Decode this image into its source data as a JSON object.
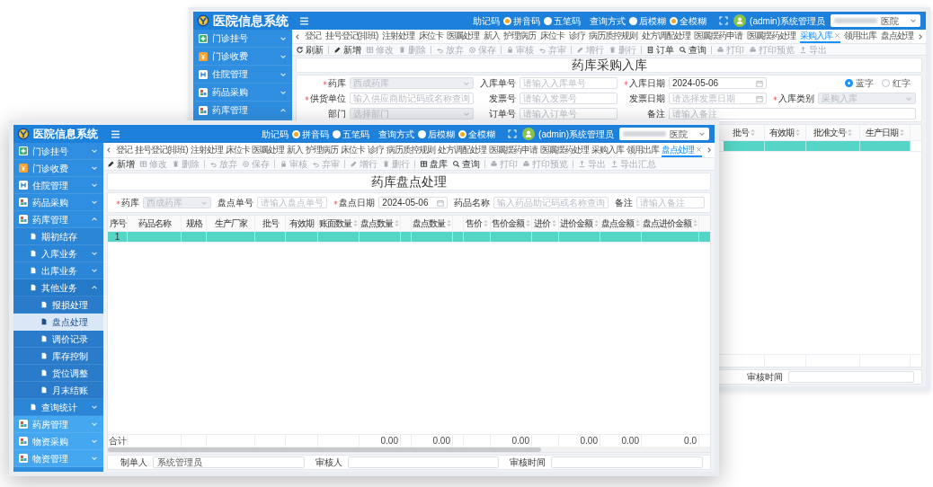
{
  "back_window": {
    "logo_text": "医院信息系统",
    "header": {
      "mnemonic_label": "助记码",
      "mnemonic_options": [
        {
          "label": "拼音码",
          "selected": true
        },
        {
          "label": "五笔码",
          "selected": false
        }
      ],
      "query_label": "查询方式",
      "query_options": [
        {
          "label": "后模糊",
          "selected": false
        },
        {
          "label": "全模糊",
          "selected": true
        }
      ],
      "user": "(admin)系统管理员",
      "hospital": "医院"
    },
    "sidebar": [
      {
        "label": "门诊挂号",
        "expanded": false,
        "selected": false
      },
      {
        "label": "门诊收费",
        "expanded": false,
        "selected": false
      },
      {
        "label": "住院管理",
        "expanded": false,
        "selected": false
      },
      {
        "label": "药品采购",
        "expanded": false,
        "selected": false
      },
      {
        "label": "药库管理",
        "expanded": true,
        "selected": false
      }
    ],
    "tabs": [
      {
        "label": "登记",
        "selected": false
      },
      {
        "label": "挂号登记(排班)",
        "selected": false
      },
      {
        "label": "注射处理",
        "selected": false
      },
      {
        "label": "床位卡",
        "selected": false
      },
      {
        "label": "医嘱处理",
        "selected": false
      },
      {
        "label": "新入",
        "selected": false
      },
      {
        "label": "护理病历",
        "selected": false
      },
      {
        "label": "床位卡",
        "selected": false
      },
      {
        "label": "诊疗",
        "selected": false
      },
      {
        "label": "病历质控规则",
        "selected": false
      },
      {
        "label": "处方调配处理",
        "selected": false
      },
      {
        "label": "医嘱摆药申请",
        "selected": false
      },
      {
        "label": "医嘱摆药处理",
        "selected": false
      },
      {
        "label": "采购入库",
        "selected": true
      },
      {
        "label": "领用出库",
        "selected": false
      },
      {
        "label": "盘点处理",
        "selected": false
      }
    ],
    "toolbar": [
      [
        {
          "label": "刷新",
          "disabled": false
        }
      ],
      [
        {
          "label": "新增",
          "disabled": false
        },
        {
          "label": "修改",
          "disabled": true
        },
        {
          "label": "删除",
          "disabled": true
        }
      ],
      [
        {
          "label": "放弃",
          "disabled": true
        },
        {
          "label": "保存",
          "disabled": true
        }
      ],
      [
        {
          "label": "审核",
          "disabled": true
        },
        {
          "label": "弃审",
          "disabled": true
        }
      ],
      [
        {
          "label": "增行",
          "disabled": true
        },
        {
          "label": "删行",
          "disabled": true
        }
      ],
      [
        {
          "label": "订单",
          "disabled": false
        },
        {
          "label": "查询",
          "disabled": false
        }
      ],
      [
        {
          "label": "打印",
          "disabled": true
        },
        {
          "label": "打印预览",
          "disabled": true
        },
        {
          "label": "导出",
          "disabled": true
        }
      ]
    ],
    "page_title": "药库采购入库",
    "form": [
      [
        {
          "label": "药库",
          "required": true,
          "kind": "select",
          "value": "西成药库",
          "disabled": true
        },
        {
          "label": "入库单号",
          "required": false,
          "kind": "text",
          "placeholder": "请输入入库单号",
          "disabled": false
        },
        {
          "label": "入库日期",
          "required": true,
          "kind": "date",
          "value": "2024-05-06",
          "disabled": false
        },
        {
          "kind": "radio",
          "options": [
            {
              "label": "蓝字",
              "selected": true
            },
            {
              "label": "红字",
              "selected": false
            }
          ]
        }
      ],
      [
        {
          "label": "供货单位",
          "required": true,
          "kind": "text",
          "placeholder": "输入供应商助记码或名称查询",
          "disabled": false
        },
        {
          "label": "发票号",
          "required": false,
          "kind": "text",
          "placeholder": "请输入发票号",
          "disabled": false
        },
        {
          "label": "发票日期",
          "required": false,
          "kind": "date",
          "placeholder": "请选择发票日期",
          "disabled": false
        },
        {
          "label": "入库类别",
          "required": true,
          "kind": "select",
          "value": "采购入库",
          "disabled": true
        }
      ],
      [
        {
          "label": "部门",
          "required": false,
          "kind": "select",
          "placeholder": "选择部门",
          "disabled": true
        },
        {
          "label": "订单号",
          "required": false,
          "kind": "text",
          "placeholder": "请输入订单号",
          "disabled": false
        },
        {
          "label": "备注",
          "required": false,
          "kind": "text",
          "placeholder": "请输入备注",
          "disabled": false
        }
      ]
    ],
    "table": {
      "columns": [
        {
          "label": "批号",
          "sortable": true
        },
        {
          "label": "有效期",
          "sortable": true
        },
        {
          "label": "批准文号",
          "sortable": true
        },
        {
          "label": "生产日期",
          "sortable": true
        }
      ],
      "rows": [
        {
          "selected": true
        }
      ]
    },
    "footer": [
      {
        "label": "审核时间"
      }
    ]
  },
  "front_window": {
    "logo_text": "医院信息系统",
    "header": {
      "mnemonic_label": "助记码",
      "mnemonic_options": [
        {
          "label": "拼音码",
          "selected": true
        },
        {
          "label": "五笔码",
          "selected": false
        }
      ],
      "query_label": "查询方式",
      "query_options": [
        {
          "label": "后模糊",
          "selected": false
        },
        {
          "label": "全模糊",
          "selected": true
        }
      ],
      "user": "(admin)系统管理员",
      "hospital": "医院"
    },
    "sidebar": [
      {
        "label": "门诊挂号",
        "expanded": false,
        "selected": false
      },
      {
        "label": "门诊收费",
        "expanded": false,
        "selected": false
      },
      {
        "label": "住院管理",
        "expanded": false,
        "selected": false
      },
      {
        "label": "药品采购",
        "expanded": false,
        "selected": false
      },
      {
        "label": "药库管理",
        "expanded": true,
        "selected": false,
        "children": [
          {
            "label": "期初结存",
            "selected": false
          },
          {
            "label": "入库业务",
            "expanded": false,
            "selected": false
          },
          {
            "label": "出库业务",
            "expanded": false,
            "selected": false
          },
          {
            "label": "其他业务",
            "expanded": true,
            "selected": false,
            "children": [
              {
                "label": "报损处理",
                "selected": false
              },
              {
                "label": "盘点处理",
                "selected": true
              },
              {
                "label": "调价记录",
                "selected": false
              },
              {
                "label": "库存控制",
                "selected": false
              },
              {
                "label": "货位调整",
                "selected": false
              },
              {
                "label": "月末结账",
                "selected": false
              }
            ]
          },
          {
            "label": "查询统计",
            "expanded": false,
            "selected": false
          }
        ]
      },
      {
        "label": "药房管理",
        "expanded": false,
        "selected": false
      },
      {
        "label": "物资采购",
        "expanded": false,
        "selected": false
      },
      {
        "label": "物资管理",
        "expanded": false,
        "selected": false
      }
    ],
    "tabs": [
      {
        "label": "登记",
        "selected": false
      },
      {
        "label": "挂号登记(排班)",
        "selected": false
      },
      {
        "label": "注射处理",
        "selected": false
      },
      {
        "label": "床位卡",
        "selected": false
      },
      {
        "label": "医嘱处理",
        "selected": false
      },
      {
        "label": "新入",
        "selected": false
      },
      {
        "label": "护理病历",
        "selected": false
      },
      {
        "label": "床位卡",
        "selected": false
      },
      {
        "label": "诊疗",
        "selected": false
      },
      {
        "label": "病历质控规则",
        "selected": false
      },
      {
        "label": "处方调配处理",
        "selected": false
      },
      {
        "label": "医嘱摆药申请",
        "selected": false
      },
      {
        "label": "医嘱摆药处理",
        "selected": false
      },
      {
        "label": "采购入库",
        "selected": false
      },
      {
        "label": "领用出库",
        "selected": false
      },
      {
        "label": "盘点处理",
        "selected": true
      }
    ],
    "toolbar": [
      [
        {
          "label": "新增",
          "disabled": false
        },
        {
          "label": "修改",
          "disabled": true
        },
        {
          "label": "删除",
          "disabled": true
        }
      ],
      [
        {
          "label": "放弃",
          "disabled": true
        },
        {
          "label": "保存",
          "disabled": true
        }
      ],
      [
        {
          "label": "审核",
          "disabled": true
        },
        {
          "label": "弃审",
          "disabled": true
        }
      ],
      [
        {
          "label": "增行",
          "disabled": true
        },
        {
          "label": "删行",
          "disabled": true
        }
      ],
      [
        {
          "label": "盘库",
          "disabled": false
        },
        {
          "label": "查询",
          "disabled": false
        }
      ],
      [
        {
          "label": "打印",
          "disabled": true
        },
        {
          "label": "打印预览",
          "disabled": true
        }
      ],
      [
        {
          "label": "导出",
          "disabled": true
        },
        {
          "label": "导出汇总",
          "disabled": true
        }
      ]
    ],
    "page_title": "药库盘点处理",
    "form": [
      [
        {
          "label": "药库",
          "required": true,
          "kind": "select",
          "value": "西成药库",
          "disabled": true
        },
        {
          "label": "盘点单号",
          "required": false,
          "kind": "text",
          "placeholder": "请输入盘点单号",
          "disabled": false
        },
        {
          "label": "盘点日期",
          "required": true,
          "kind": "date",
          "value": "2024-05-06",
          "disabled": false
        },
        {
          "label": "药品名称",
          "required": false,
          "kind": "text",
          "placeholder": "输入药品助记码或名称查询",
          "disabled": false
        },
        {
          "label": "备注",
          "required": false,
          "kind": "text",
          "placeholder": "请输入备注",
          "disabled": false
        }
      ]
    ],
    "table": {
      "columns": [
        {
          "label": "序号",
          "sortable": false
        },
        {
          "label": "药品名称",
          "sortable": false
        },
        {
          "label": "规格",
          "sortable": false
        },
        {
          "label": "生产厂家",
          "sortable": false
        },
        {
          "label": "批号",
          "sortable": false
        },
        {
          "label": "有效期",
          "sortable": false
        },
        {
          "label": "账面数量",
          "sortable": true
        },
        {
          "label": "盘点数量",
          "sortable": true,
          "total": "0.00"
        },
        {
          "kind": "spacer"
        },
        {
          "label": "盘点数量",
          "sortable": true,
          "total": "0.00"
        },
        {
          "kind": "spacer"
        },
        {
          "label": "售价",
          "sortable": true
        },
        {
          "label": "售价金额",
          "sortable": true,
          "total": "0.00"
        },
        {
          "label": "进价",
          "sortable": true
        },
        {
          "label": "进价金额",
          "sortable": true,
          "total": "0.00"
        },
        {
          "label": "盘点金额",
          "sortable": true,
          "total": "0.00"
        },
        {
          "label": "盘点进价金额",
          "sortable": true,
          "total": "0.0"
        }
      ],
      "rows": [
        {
          "selected": true,
          "cells": [
            "1"
          ]
        }
      ],
      "total_label": "合计"
    },
    "footer": [
      {
        "label": "制单人",
        "value": "系统管理员"
      },
      {
        "label": "审核人"
      },
      {
        "label": "审核时间"
      }
    ]
  }
}
